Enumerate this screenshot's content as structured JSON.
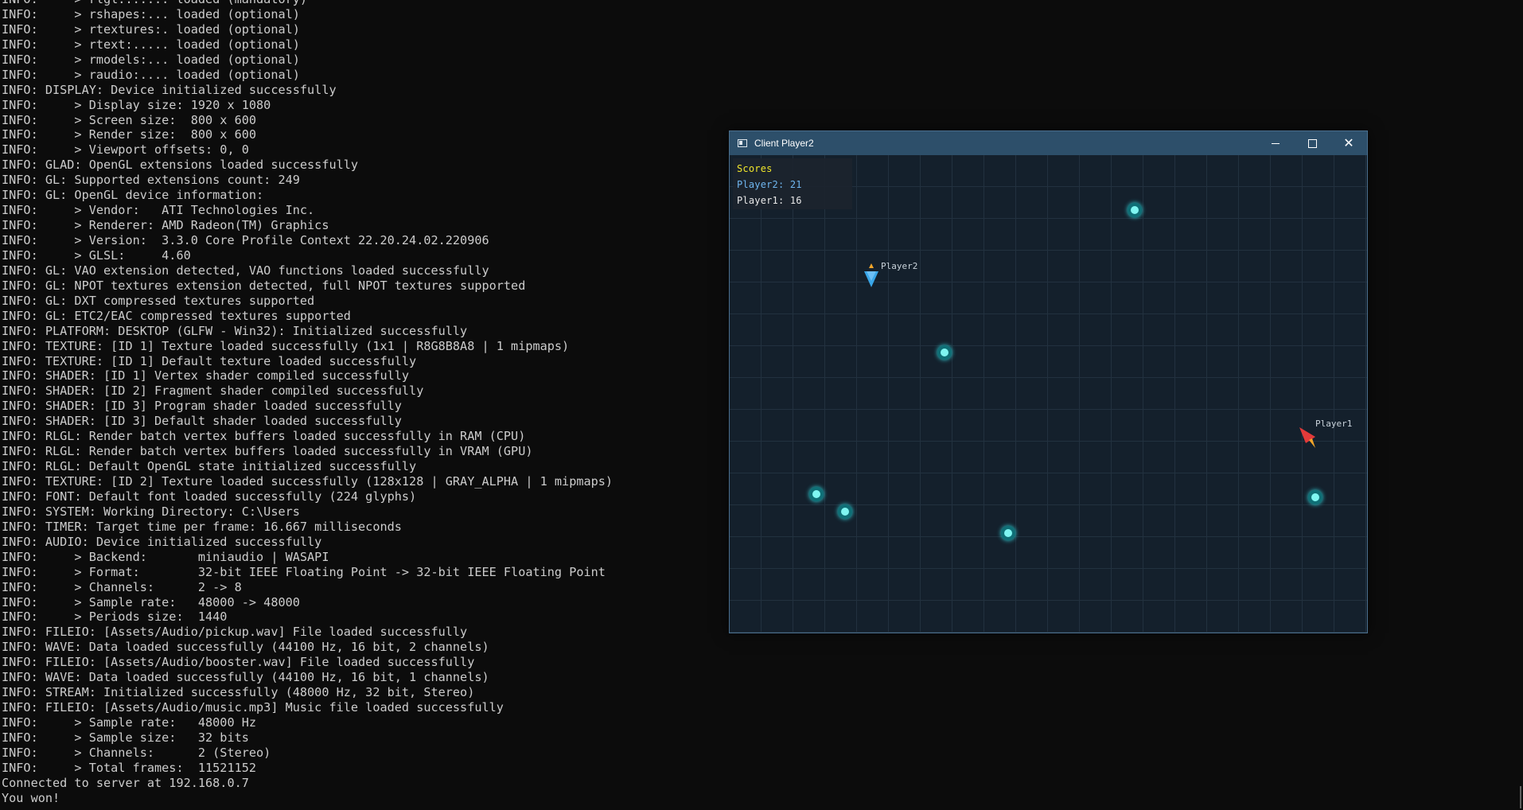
{
  "console": {
    "lines": [
      "INFO:     > rlgl:...... loaded (mandatory)",
      "INFO:     > rshapes:... loaded (optional)",
      "INFO:     > rtextures:. loaded (optional)",
      "INFO:     > rtext:..... loaded (optional)",
      "INFO:     > rmodels:... loaded (optional)",
      "INFO:     > raudio:.... loaded (optional)",
      "INFO: DISPLAY: Device initialized successfully",
      "INFO:     > Display size: 1920 x 1080",
      "INFO:     > Screen size:  800 x 600",
      "INFO:     > Render size:  800 x 600",
      "INFO:     > Viewport offsets: 0, 0",
      "INFO: GLAD: OpenGL extensions loaded successfully",
      "INFO: GL: Supported extensions count: 249",
      "INFO: GL: OpenGL device information:",
      "INFO:     > Vendor:   ATI Technologies Inc.",
      "INFO:     > Renderer: AMD Radeon(TM) Graphics",
      "INFO:     > Version:  3.3.0 Core Profile Context 22.20.24.02.220906",
      "INFO:     > GLSL:     4.60",
      "INFO: GL: VAO extension detected, VAO functions loaded successfully",
      "INFO: GL: NPOT textures extension detected, full NPOT textures supported",
      "INFO: GL: DXT compressed textures supported",
      "INFO: GL: ETC2/EAC compressed textures supported",
      "INFO: PLATFORM: DESKTOP (GLFW - Win32): Initialized successfully",
      "INFO: TEXTURE: [ID 1] Texture loaded successfully (1x1 | R8G8B8A8 | 1 mipmaps)",
      "INFO: TEXTURE: [ID 1] Default texture loaded successfully",
      "INFO: SHADER: [ID 1] Vertex shader compiled successfully",
      "INFO: SHADER: [ID 2] Fragment shader compiled successfully",
      "INFO: SHADER: [ID 3] Program shader loaded successfully",
      "INFO: SHADER: [ID 3] Default shader loaded successfully",
      "INFO: RLGL: Render batch vertex buffers loaded successfully in RAM (CPU)",
      "INFO: RLGL: Render batch vertex buffers loaded successfully in VRAM (GPU)",
      "INFO: RLGL: Default OpenGL state initialized successfully",
      "INFO: TEXTURE: [ID 2] Texture loaded successfully (128x128 | GRAY_ALPHA | 1 mipmaps)",
      "INFO: FONT: Default font loaded successfully (224 glyphs)",
      "INFO: SYSTEM: Working Directory: C:\\Users",
      "INFO: TIMER: Target time per frame: 16.667 milliseconds",
      "INFO: AUDIO: Device initialized successfully",
      "INFO:     > Backend:       miniaudio | WASAPI",
      "INFO:     > Format:        32-bit IEEE Floating Point -> 32-bit IEEE Floating Point",
      "INFO:     > Channels:      2 -> 8",
      "INFO:     > Sample rate:   48000 -> 48000",
      "INFO:     > Periods size:  1440",
      "INFO: FILEIO: [Assets/Audio/pickup.wav] File loaded successfully",
      "INFO: WAVE: Data loaded successfully (44100 Hz, 16 bit, 2 channels)",
      "INFO: FILEIO: [Assets/Audio/booster.wav] File loaded successfully",
      "INFO: WAVE: Data loaded successfully (44100 Hz, 16 bit, 1 channels)",
      "INFO: STREAM: Initialized successfully (48000 Hz, 32 bit, Stereo)",
      "INFO: FILEIO: [Assets/Audio/music.mp3] Music file loaded successfully",
      "INFO:     > Sample rate:   48000 Hz",
      "INFO:     > Sample size:   32 bits",
      "INFO:     > Channels:      2 (Stereo)",
      "INFO:     > Total frames:  11521152",
      "Connected to server at 192.168.0.7",
      "You won!"
    ]
  },
  "window": {
    "title": "Client Player2",
    "icons": {
      "app": "app-window-icon",
      "minimize": "minimize-icon",
      "maximize": "maximize-icon",
      "close": "close-icon"
    }
  },
  "game": {
    "scores": {
      "heading": "Scores",
      "heading_color": "#f0e62a",
      "rows": [
        {
          "text": "Player2: 21",
          "color": "#6fb6f0"
        },
        {
          "text": "Player1: 16",
          "color": "#e8e8e8"
        }
      ]
    },
    "players": [
      {
        "name": "Player2",
        "color": "#39a6e8"
      },
      {
        "name": "Player1",
        "color": "#e23a3a"
      }
    ],
    "pickup_color": "#7ff6f2",
    "background_color": "#14202c"
  }
}
